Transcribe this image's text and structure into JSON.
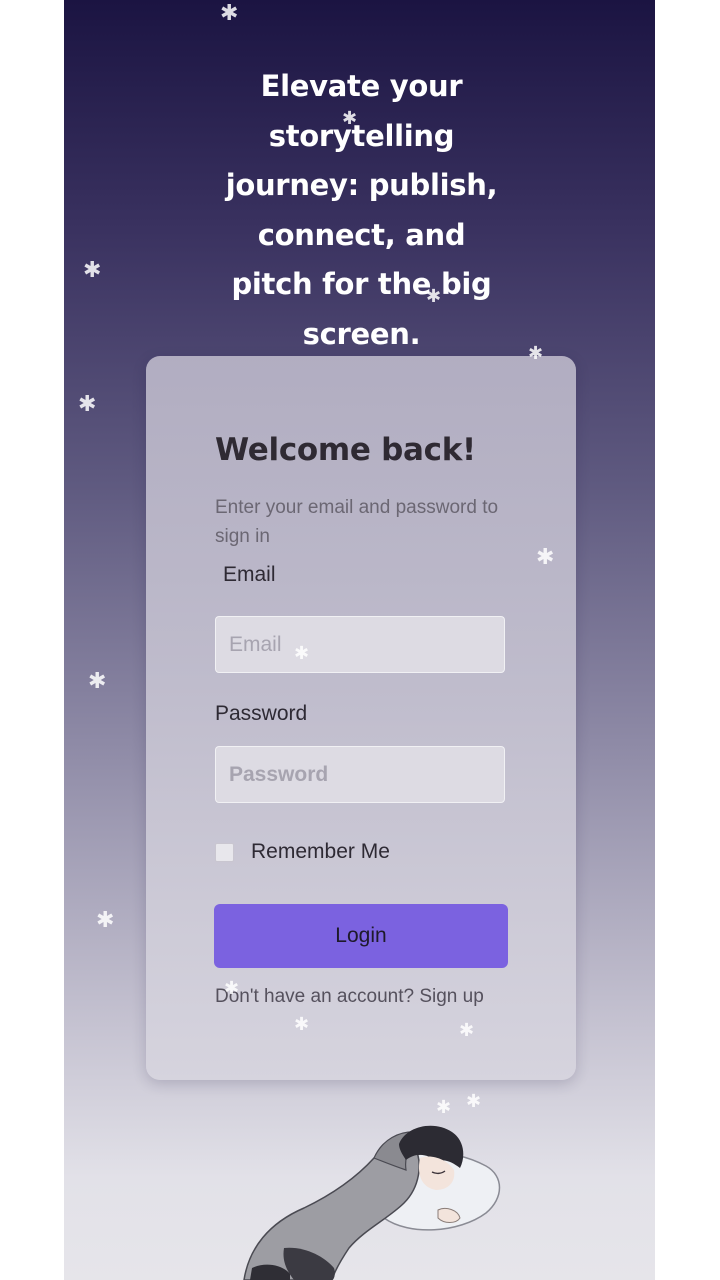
{
  "hero": {
    "headline": "Elevate your storytelling journey: publish, connect, and pitch for the big screen."
  },
  "login_card": {
    "title": "Welcome back!",
    "subtitle": "Enter your email and password to sign in",
    "email_label": "Email",
    "email_placeholder": "Email",
    "password_label": "Password",
    "password_placeholder": "Password",
    "remember_label": "Remember Me",
    "remember_checked": false,
    "login_label": "Login",
    "signup_prompt": "Don't have an account?",
    "signup_link": "Sign up"
  },
  "icons": {
    "sparkle": "sparkle-icon",
    "illustration": "sleeping-character-illustration"
  },
  "colors": {
    "accent": "#7b62e0",
    "background_top": "#1b1442",
    "background_bottom": "#e6e5ea"
  }
}
